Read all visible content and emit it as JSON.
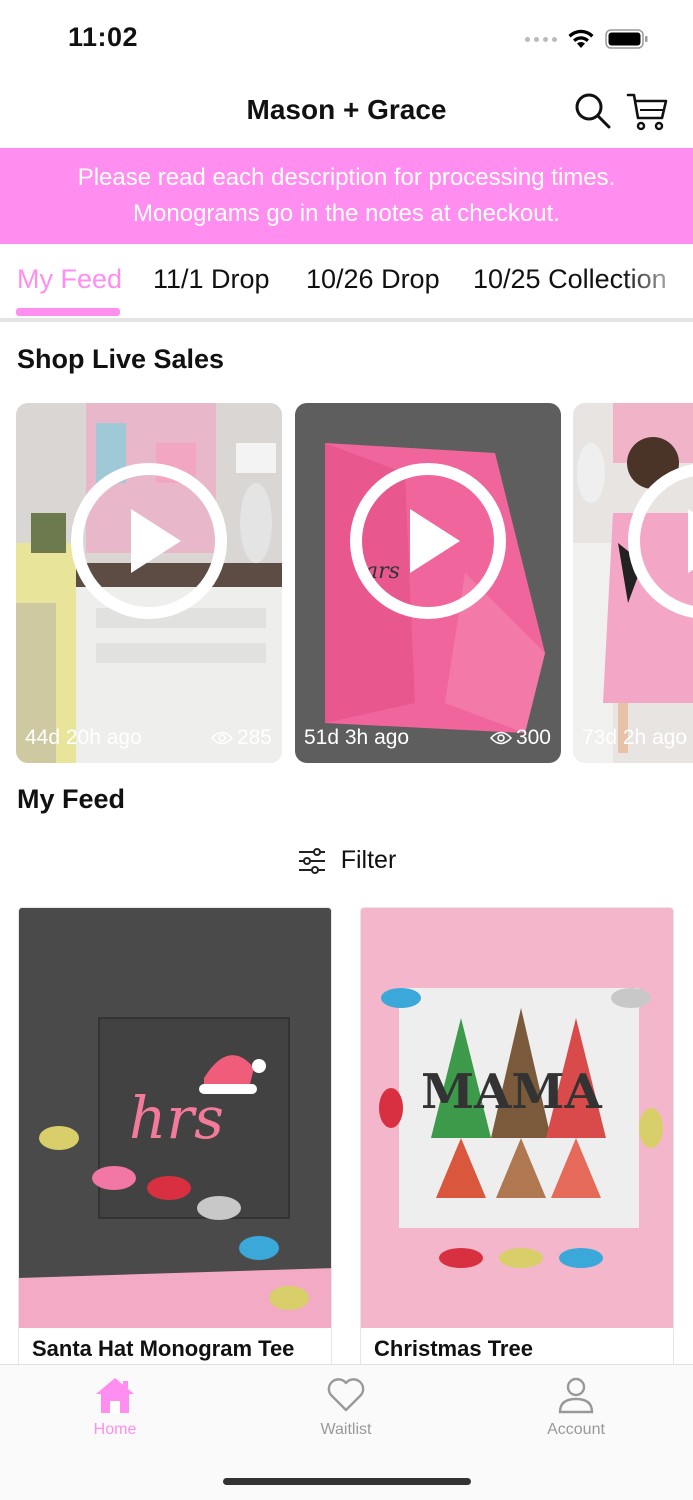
{
  "status_bar": {
    "time": "11:02"
  },
  "header": {
    "title": "Mason + Grace"
  },
  "banner": {
    "line1": "Please read each description for processing times.",
    "line2": "Monograms go in the notes at checkout."
  },
  "tabs": [
    {
      "label": "My Feed",
      "active": true
    },
    {
      "label": "11/1 Drop",
      "active": false
    },
    {
      "label": "10/26 Drop",
      "active": false
    },
    {
      "label": "10/25 Collection",
      "active": false
    }
  ],
  "live_sales": {
    "title": "Shop Live Sales",
    "items": [
      {
        "time": "44d 20h ago",
        "views": "285"
      },
      {
        "time": "51d 3h ago",
        "views": "300"
      },
      {
        "time": "73d 2h ago",
        "views": ""
      }
    ]
  },
  "feed": {
    "title": "My Feed",
    "filter_label": "Filter",
    "products": [
      {
        "name": "Santa Hat Monogram Tee"
      },
      {
        "name": "Christmas Tree"
      }
    ]
  },
  "tabbar": {
    "items": [
      {
        "label": "Home",
        "icon": "home-icon",
        "active": true
      },
      {
        "label": "Waitlist",
        "icon": "heart-icon",
        "active": false
      },
      {
        "label": "Account",
        "icon": "person-icon",
        "active": false
      }
    ]
  },
  "colors": {
    "accent": "#ff8ef0",
    "banner_bg": "#ff8ef0",
    "tabbar_inactive": "#999999"
  }
}
